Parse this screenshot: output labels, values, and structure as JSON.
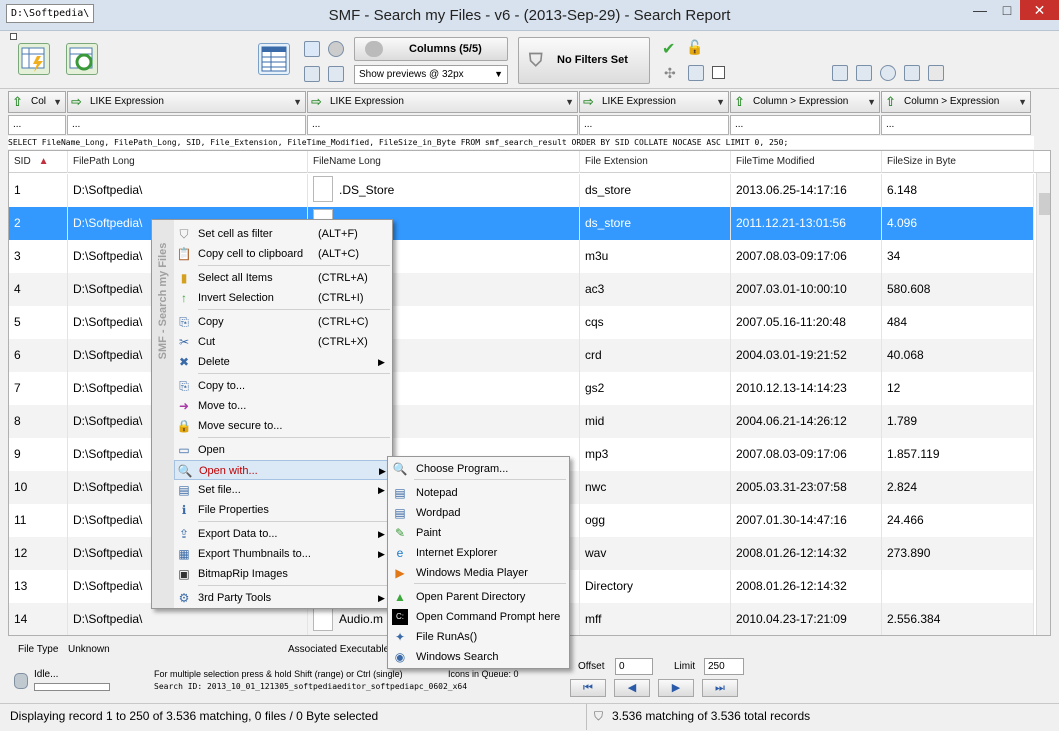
{
  "window": {
    "title": "SMF - Search my Files - v6 - (2013-Sep-29) - Search Report",
    "path": "D:\\Softpedia\\",
    "minimize": "—",
    "maximize": "□",
    "close": "✕"
  },
  "toolbar": {
    "columns_label": "Columns (5/5)",
    "preview_value": "Show previews @ 32px",
    "filters_label": "No Filters Set"
  },
  "filters": [
    {
      "label": "Col",
      "arrow": "⇧"
    },
    {
      "label": "LIKE Expression",
      "arrow": "⇨"
    },
    {
      "label": "LIKE Expression",
      "arrow": "⇨"
    },
    {
      "label": "LIKE Expression",
      "arrow": "⇨"
    },
    {
      "label": "Column > Expression",
      "arrow": "⇧"
    },
    {
      "label": "Column > Expression",
      "arrow": "⇧"
    }
  ],
  "filter_values": [
    "...",
    "...",
    "...",
    "...",
    "...",
    "..."
  ],
  "sql": "SELECT FileName_Long, FilePath_Long, SID, File_Extension, FileTime_Modified, FileSize_in_Byte FROM smf_search_result ORDER BY SID COLLATE NOCASE ASC LIMIT 0, 250;",
  "grid": {
    "headers": [
      "SID",
      "FilePath Long",
      "FileName Long",
      "File Extension",
      "FileTime Modified",
      "FileSize in Byte"
    ],
    "sort_arrow": "▲",
    "rows": [
      {
        "sid": "1",
        "path": "D:\\Softpedia\\",
        "name": ".DS_Store",
        "ext": "ds_store",
        "time": "2013.06.25-14:17:16",
        "size": "6.148"
      },
      {
        "sid": "2",
        "path": "D:\\Softpedia\\",
        "name": "store",
        "ext": "ds_store",
        "time": "2011.12.21-13:01:56",
        "size": "4.096"
      },
      {
        "sid": "3",
        "path": "D:\\Softpedia\\",
        "name": "m3u",
        "ext": "m3u",
        "time": "2007.08.03-09:17:06",
        "size": "34"
      },
      {
        "sid": "4",
        "path": "D:\\Softpedia\\",
        "name": "a.ac3",
        "ext": "ac3",
        "time": "2007.03.01-10:00:10",
        "size": "580.608"
      },
      {
        "sid": "5",
        "path": "D:\\Softpedia\\",
        "name": "a.cqs",
        "ext": "cqs",
        "time": "2007.05.16-11:20:48",
        "size": "484"
      },
      {
        "sid": "6",
        "path": "D:\\Softpedia\\",
        "name": "a.crd",
        "ext": "crd",
        "time": "2004.03.01-19:21:52",
        "size": "40.068"
      },
      {
        "sid": "7",
        "path": "D:\\Softpedia\\",
        "name": "a.gs2",
        "ext": "gs2",
        "time": "2010.12.13-14:14:23",
        "size": "12"
      },
      {
        "sid": "8",
        "path": "D:\\Softpedia\\",
        "name": "a.mid",
        "ext": "mid",
        "time": "2004.06.21-14:26:12",
        "size": "1.789"
      },
      {
        "sid": "9",
        "path": "D:\\Softpedia\\",
        "name": "a.mp3",
        "ext": "mp3",
        "time": "2007.08.03-09:17:06",
        "size": "1.857.119"
      },
      {
        "sid": "10",
        "path": "D:\\Softpedia\\",
        "name": "",
        "ext": "nwc",
        "time": "2005.03.31-23:07:58",
        "size": "2.824"
      },
      {
        "sid": "11",
        "path": "D:\\Softpedia\\",
        "name": "",
        "ext": "ogg",
        "time": "2007.01.30-14:47:16",
        "size": "24.466"
      },
      {
        "sid": "12",
        "path": "D:\\Softpedia\\",
        "name": "",
        "ext": "wav",
        "time": "2008.01.26-12:14:32",
        "size": "273.890"
      },
      {
        "sid": "13",
        "path": "D:\\Softpedia\\",
        "name": "",
        "ext": "Directory",
        "time": "2008.01.26-12:14:32",
        "size": ""
      },
      {
        "sid": "14",
        "path": "D:\\Softpedia\\",
        "name": "Audio.m",
        "ext": "mff",
        "time": "2010.04.23-17:21:09",
        "size": "2.556.384"
      }
    ],
    "selected_row": 2
  },
  "context_menu": {
    "side_label": "SMF - Search my Files",
    "items": [
      {
        "label": "Set cell as filter",
        "shortcut": "(ALT+F)",
        "icon": "⛉"
      },
      {
        "label": "Copy cell to clipboard",
        "shortcut": "(ALT+C)",
        "icon": "📋"
      },
      {
        "label": "Select all Items",
        "shortcut": "(CTRL+A)",
        "icon": "▮"
      },
      {
        "label": "Invert Selection",
        "shortcut": "(CTRL+I)",
        "icon": "↑"
      },
      {
        "label": "Copy",
        "shortcut": "(CTRL+C)",
        "icon": "⎘"
      },
      {
        "label": "Cut",
        "shortcut": "(CTRL+X)",
        "icon": "✂"
      },
      {
        "label": "Delete",
        "shortcut": "",
        "icon": "✖"
      },
      {
        "label": "Copy to...",
        "shortcut": "",
        "icon": "⎘"
      },
      {
        "label": "Move to...",
        "shortcut": "",
        "icon": "➜"
      },
      {
        "label": "Move secure to...",
        "shortcut": "",
        "icon": "🔒"
      },
      {
        "label": "Open",
        "shortcut": "",
        "icon": "▭"
      },
      {
        "label": "Open with...",
        "shortcut": "",
        "icon": "🔍"
      },
      {
        "label": "Set file...",
        "shortcut": "",
        "icon": "▤"
      },
      {
        "label": "File Properties",
        "shortcut": "",
        "icon": "ℹ"
      },
      {
        "label": "Export Data to...",
        "shortcut": "",
        "icon": "⇪"
      },
      {
        "label": "Export Thumbnails to...",
        "shortcut": "",
        "icon": "▦"
      },
      {
        "label": "BitmapRip Images",
        "shortcut": "",
        "icon": "▣"
      },
      {
        "label": "3rd Party Tools",
        "shortcut": "",
        "icon": "⚙"
      }
    ]
  },
  "submenu": {
    "items": [
      {
        "label": "Choose Program...",
        "icon": "🔍"
      },
      {
        "label": "Notepad",
        "icon": "▤"
      },
      {
        "label": "Wordpad",
        "icon": "▤"
      },
      {
        "label": "Paint",
        "icon": "✎"
      },
      {
        "label": "Internet Explorer",
        "icon": "e"
      },
      {
        "label": "Windows Media Player",
        "icon": "▶"
      },
      {
        "label": "Open Parent Directory",
        "icon": "▲"
      },
      {
        "label": "Open Command Prompt here",
        "icon": "C:"
      },
      {
        "label": "File RunAs()",
        "icon": "✦"
      },
      {
        "label": "Windows Search",
        "icon": "◉"
      }
    ]
  },
  "info": {
    "file_type_label": "File Type",
    "file_type_value": "Unknown",
    "assoc_label": "Associated Executable"
  },
  "bottom": {
    "idle": "Idle...",
    "hint": "For multiple selection press & hold Shift (range) or Ctrl (single)",
    "search_id": "Search ID: 2013_10_01_121305_softpediaeditor_softpediapc_0602_x64",
    "icons_queue": "Icons in Queue:  0",
    "offset_label": "Offset",
    "offset_value": "0",
    "limit_label": "Limit",
    "limit_value": "250",
    "nav": [
      "⏮",
      "◀",
      "▶",
      "⏭"
    ]
  },
  "status": {
    "left": "Displaying record 1 to 250 of 3.536 matching, 0 files / 0 Byte selected",
    "right": "3.536 matching of 3.536 total records"
  }
}
